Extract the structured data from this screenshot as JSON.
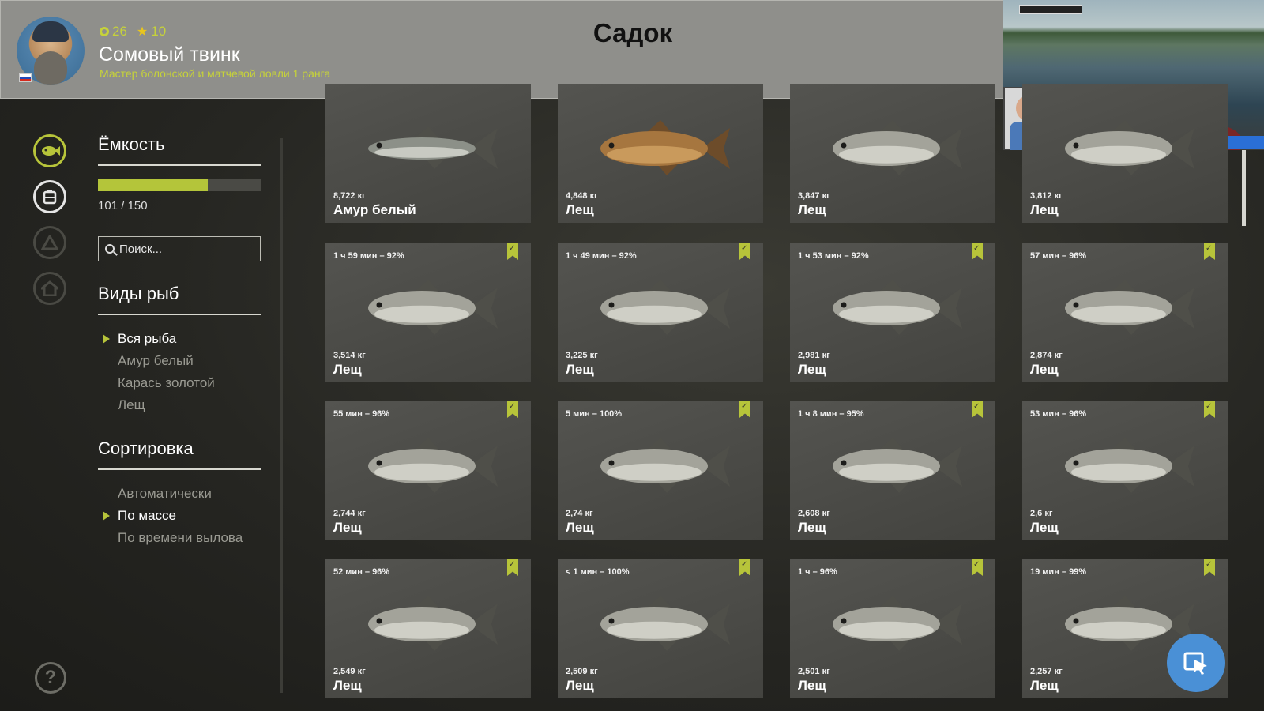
{
  "header": {
    "level": "26",
    "stars": "10",
    "player_name": "Сомовый твинк",
    "player_rank": "Мастер болонской и матчевой ловли 1 ранга",
    "title": "Садок"
  },
  "capacity": {
    "title": "Ёмкость",
    "current": 101,
    "max": 150,
    "text": "101 / 150",
    "fill_fraction": 0.673
  },
  "search": {
    "placeholder": "Поиск..."
  },
  "species": {
    "title": "Виды рыб",
    "items": [
      {
        "label": "Вся рыба",
        "selected": true
      },
      {
        "label": "Амур белый",
        "selected": false
      },
      {
        "label": "Карась золотой",
        "selected": false
      },
      {
        "label": "Лещ",
        "selected": false
      }
    ]
  },
  "sorting": {
    "title": "Сортировка",
    "items": [
      {
        "label": "Автоматически",
        "selected": false
      },
      {
        "label": "По массе",
        "selected": true
      },
      {
        "label": "По времени вылова",
        "selected": false
      }
    ]
  },
  "cards": [
    {
      "meta": "",
      "weight": "8,722 кг",
      "name": "Амур белый",
      "fish": "amur",
      "bookmark": false
    },
    {
      "meta": "",
      "weight": "4,848 кг",
      "name": "Лещ",
      "fish": "bream-gold",
      "bookmark": false
    },
    {
      "meta": "",
      "weight": "3,847 кг",
      "name": "Лещ",
      "fish": "bream",
      "bookmark": false
    },
    {
      "meta": "",
      "weight": "3,812 кг",
      "name": "Лещ",
      "fish": "bream",
      "bookmark": false
    },
    {
      "meta": "1 ч 59 мин – 92%",
      "weight": "3,514 кг",
      "name": "Лещ",
      "fish": "bream",
      "bookmark": true
    },
    {
      "meta": "1 ч 49 мин – 92%",
      "weight": "3,225 кг",
      "name": "Лещ",
      "fish": "bream",
      "bookmark": true
    },
    {
      "meta": "1 ч 53 мин – 92%",
      "weight": "2,981 кг",
      "name": "Лещ",
      "fish": "bream",
      "bookmark": true
    },
    {
      "meta": "57 мин – 96%",
      "weight": "2,874 кг",
      "name": "Лещ",
      "fish": "bream",
      "bookmark": true
    },
    {
      "meta": "55 мин – 96%",
      "weight": "2,744 кг",
      "name": "Лещ",
      "fish": "bream",
      "bookmark": true
    },
    {
      "meta": "5 мин – 100%",
      "weight": "2,74 кг",
      "name": "Лещ",
      "fish": "bream",
      "bookmark": true
    },
    {
      "meta": "1 ч 8 мин – 95%",
      "weight": "2,608 кг",
      "name": "Лещ",
      "fish": "bream",
      "bookmark": true
    },
    {
      "meta": "53 мин – 96%",
      "weight": "2,6 кг",
      "name": "Лещ",
      "fish": "bream",
      "bookmark": true
    },
    {
      "meta": "52 мин – 96%",
      "weight": "2,549 кг",
      "name": "Лещ",
      "fish": "bream",
      "bookmark": true
    },
    {
      "meta": "< 1 мин – 100%",
      "weight": "2,509 кг",
      "name": "Лещ",
      "fish": "bream",
      "bookmark": true
    },
    {
      "meta": "1 ч – 96%",
      "weight": "2,501 кг",
      "name": "Лещ",
      "fish": "bream",
      "bookmark": true
    },
    {
      "meta": "19 мин – 99%",
      "weight": "2,257 кг",
      "name": "Лещ",
      "fish": "bream",
      "bookmark": true
    }
  ],
  "sidebar_icons": [
    "fish-keepnet-icon",
    "tackle-icon",
    "camp-icon",
    "home-icon"
  ],
  "colors": {
    "accent": "#b7c43a",
    "header_bg": "#8f8f8b",
    "card_bg": "#4b4b47",
    "cursor_button": "#4a90d6"
  }
}
